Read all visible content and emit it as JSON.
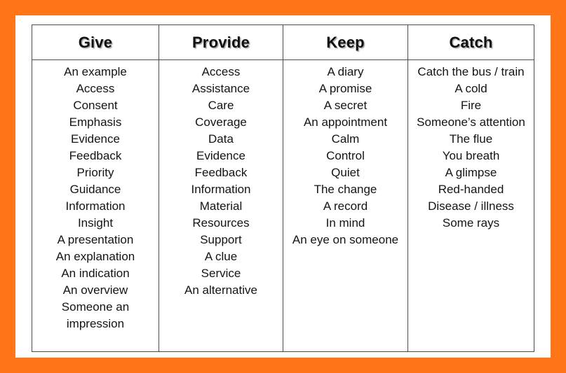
{
  "frame": {
    "accent_color": "#ff7518",
    "page_background": "#ffffff",
    "border_color": "#4d4d4d"
  },
  "table": {
    "name": "collocations-table",
    "columns": [
      {
        "header": "Give",
        "items": [
          "An example",
          "Access",
          "Consent",
          "Emphasis",
          "Evidence",
          "Feedback",
          "Priority",
          "Guidance",
          "Information",
          "Insight",
          "A presentation",
          "An explanation",
          "An indication",
          "An overview",
          "Someone an impression"
        ]
      },
      {
        "header": "Provide",
        "items": [
          "Access",
          "Assistance",
          "Care",
          "Coverage",
          "Data",
          "Evidence",
          "Feedback",
          "Information",
          "Material",
          "Resources",
          "Support",
          "A clue",
          "Service",
          "An alternative"
        ]
      },
      {
        "header": "Keep",
        "items": [
          "A diary",
          "A promise",
          "A secret",
          "An appointment",
          "Calm",
          "Control",
          "Quiet",
          "The change",
          "A record",
          "In mind",
          "An eye on someone"
        ]
      },
      {
        "header": "Catch",
        "items": [
          "Catch the bus / train",
          "A cold",
          "Fire",
          "Someone’s attention",
          "The flue",
          "You breath",
          "A glimpse",
          "Red-handed",
          "Disease / illness",
          "Some rays"
        ]
      }
    ]
  }
}
